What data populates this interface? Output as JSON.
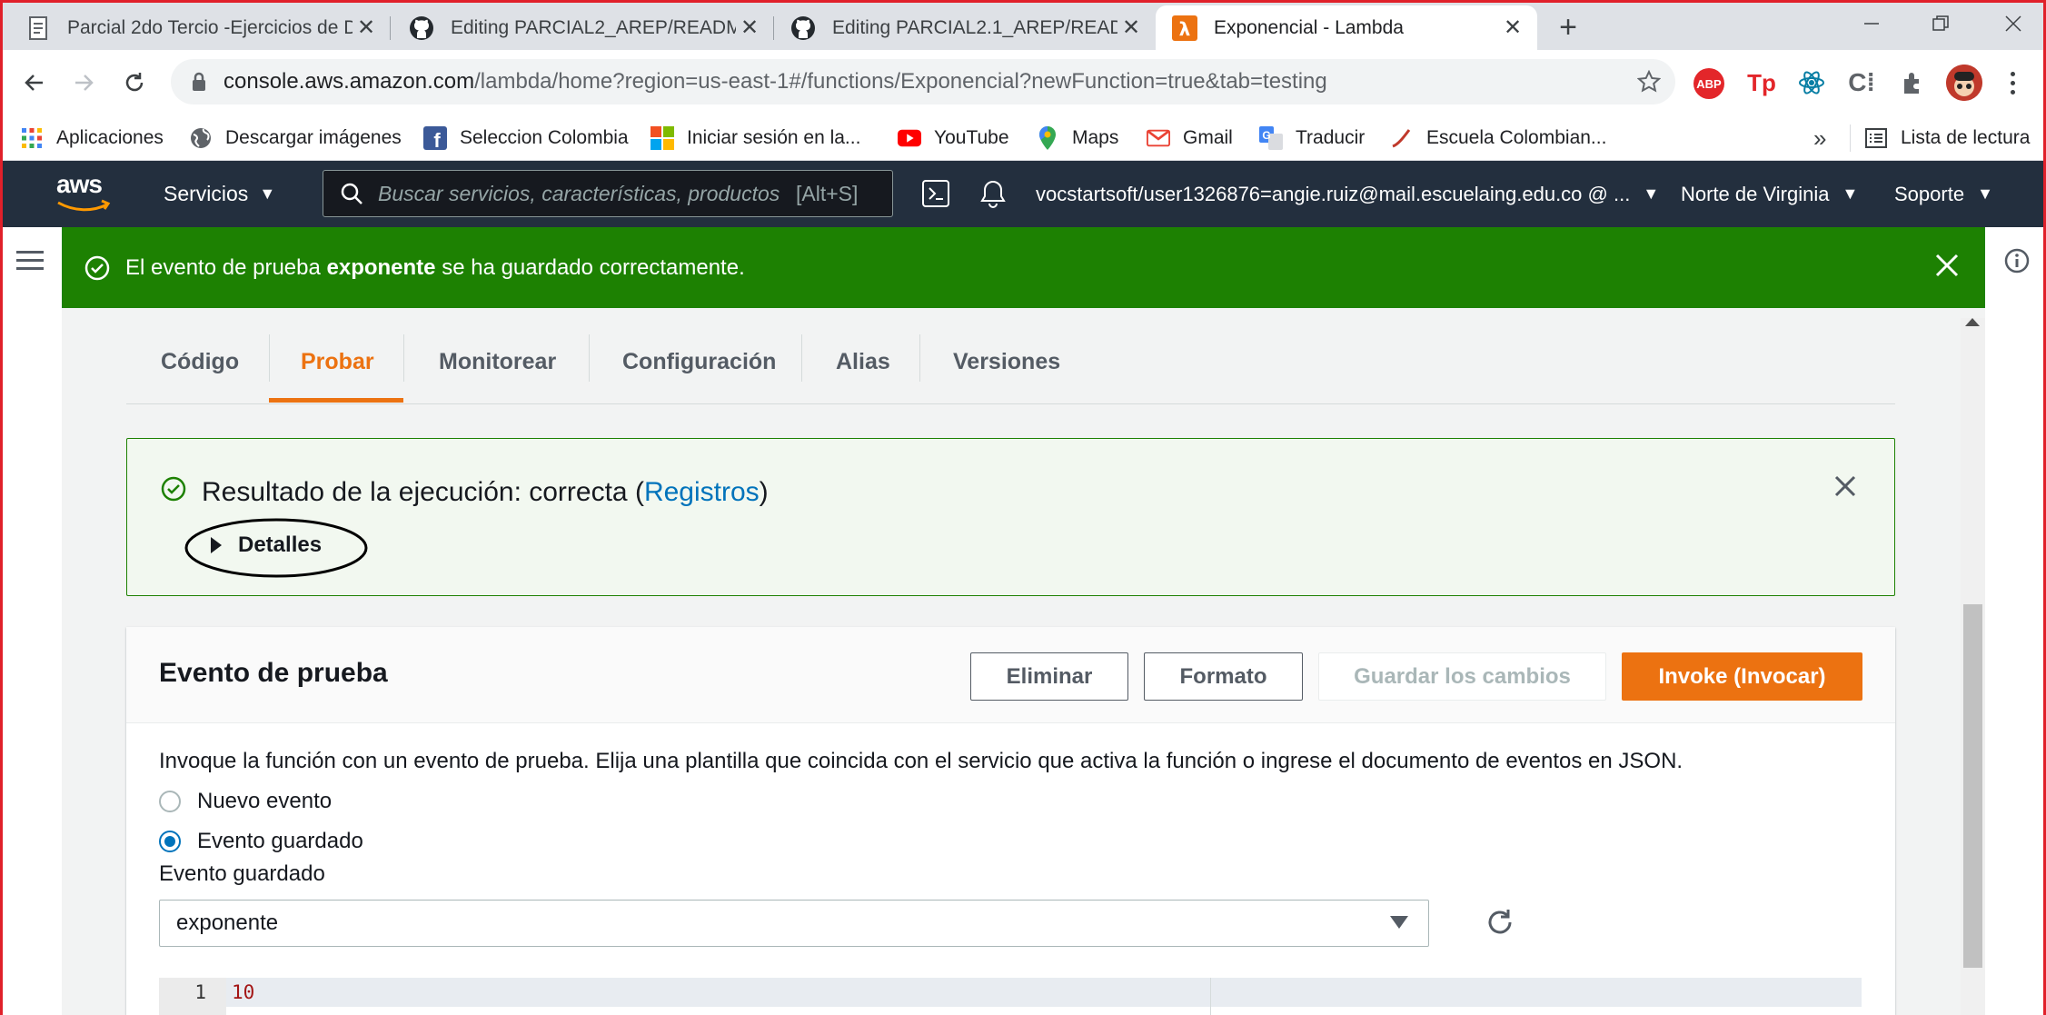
{
  "browser": {
    "tabs": [
      {
        "title": "Parcial 2do Tercio -Ejercicios de D",
        "icon": "document-icon"
      },
      {
        "title": "Editing PARCIAL2_AREP/README",
        "icon": "github-icon"
      },
      {
        "title": "Editing PARCIAL2.1_AREP/READM",
        "icon": "github-icon"
      },
      {
        "title": "Exponencial - Lambda",
        "icon": "lambda-icon"
      }
    ],
    "url_host": "console.aws.amazon.com",
    "url_path": "/lambda/home?region=us-east-1#/functions/Exponencial?newFunction=true&tab=testing",
    "bookmarks": [
      {
        "label": "Aplicaciones",
        "icon": "apps-grid-icon"
      },
      {
        "label": "Descargar imágenes",
        "icon": "globe-icon"
      },
      {
        "label": "Seleccion Colombia",
        "icon": "facebook-icon"
      },
      {
        "label": "Iniciar sesión en la...",
        "icon": "microsoft-icon"
      },
      {
        "label": "YouTube",
        "icon": "youtube-icon"
      },
      {
        "label": "Maps",
        "icon": "maps-icon"
      },
      {
        "label": "Gmail",
        "icon": "gmail-icon"
      },
      {
        "label": "Traducir",
        "icon": "translate-icon"
      },
      {
        "label": "Escuela Colombian...",
        "icon": "school-icon"
      }
    ],
    "bookmarks_more": "»",
    "reading_list": "Lista de lectura"
  },
  "aws": {
    "logo": "aws",
    "services": "Servicios",
    "search_placeholder": "Buscar servicios, características, productos",
    "search_shortcut": "[Alt+S]",
    "account": "vocstartsoft/user1326876=angie.ruiz@mail.escuelaing.edu.co @ ...",
    "region": "Norte de Virginia",
    "support": "Soporte"
  },
  "flash": {
    "prefix": "El evento de prueba ",
    "name": "exponente",
    "suffix": " se ha guardado correctamente."
  },
  "function_tabs": [
    {
      "label": "Código"
    },
    {
      "label": "Probar"
    },
    {
      "label": "Monitorear"
    },
    {
      "label": "Configuración"
    },
    {
      "label": "Alias"
    },
    {
      "label": "Versiones"
    }
  ],
  "result": {
    "text": "Resultado de la ejecución: correcta (",
    "link": "Registros",
    "close_paren": ")",
    "details": "Detalles"
  },
  "test_event": {
    "title": "Evento de prueba",
    "buttons": {
      "delete": "Eliminar",
      "format": "Formato",
      "save": "Guardar los cambios",
      "invoke": "Invoke (Invocar)"
    },
    "description": "Invoque la función con un evento de prueba. Elija una plantilla que coincida con el servicio que activa la función o ingrese el documento de eventos en JSON.",
    "radio_new": "Nuevo evento",
    "radio_saved": "Evento guardado",
    "selected_radio": "Evento guardado",
    "saved_label": "Evento guardado",
    "saved_value": "exponente",
    "editor": {
      "line_number": "1",
      "code": "10"
    }
  },
  "colors": {
    "aws_nav": "#232f3e",
    "success": "#1d8102",
    "accent_orange": "#ec7211",
    "link_blue": "#0073bb"
  }
}
